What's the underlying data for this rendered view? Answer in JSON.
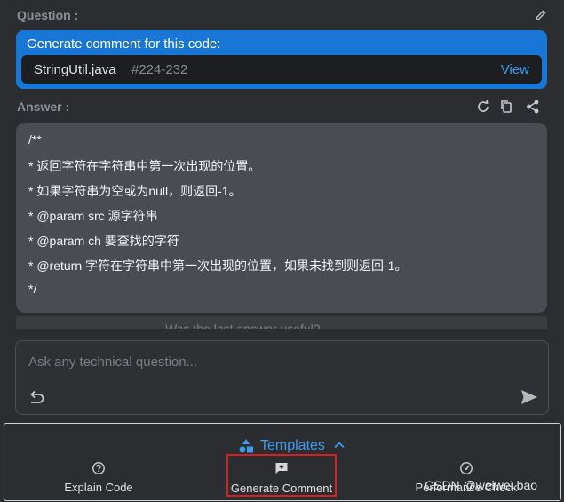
{
  "question": {
    "label": "Question :",
    "title": "Generate comment for this code:",
    "file": "StringUtil.java",
    "lines": "#224-232",
    "view": "View"
  },
  "answer": {
    "label": "Answer :",
    "lines": [
      "/**",
      " * 返回字符在字符串中第一次出现的位置。",
      " * 如果字符串为空或为null，则返回-1。",
      " * @param src 源字符串",
      " * @param ch 要查找的字符",
      " * @return 字符在字符串中第一次出现的位置，如果未找到则返回-1。",
      " */"
    ],
    "partial": "Was the last answer useful?"
  },
  "input": {
    "placeholder": "Ask any technical question..."
  },
  "templates": {
    "label": "Templates",
    "items": [
      {
        "label": "Explain Code",
        "icon": "question-icon"
      },
      {
        "label": "Generate Comment",
        "icon": "comment-plus-icon"
      },
      {
        "label": "Performance Check",
        "icon": "gauge-icon"
      }
    ]
  },
  "watermark": "CSDN @weiwei.bao",
  "colors": {
    "accent": "#1877d6",
    "link": "#3d9bf0",
    "highlight": "#d62222"
  }
}
